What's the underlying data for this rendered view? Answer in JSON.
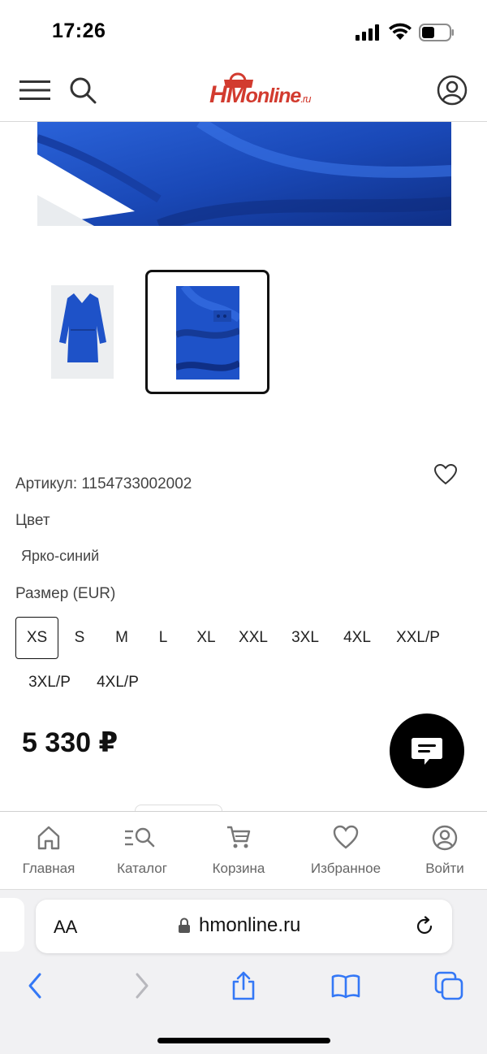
{
  "status_bar": {
    "time": "17:26"
  },
  "header": {
    "logo": {
      "hm": "HM",
      "online": "online",
      "ru": ".ru"
    }
  },
  "product": {
    "article": "Артикул: 1154733002002",
    "color_label": "Цвет",
    "color_value": "Ярко-синий",
    "size_label": "Размер (EUR)",
    "sizes": [
      "XS",
      "S",
      "M",
      "L",
      "XL",
      "XXL",
      "3XL",
      "4XL",
      "XXL/P",
      "3XL/P",
      "4XL/P"
    ],
    "selected_size": "XS",
    "price": "5 330 ₽",
    "accent_color": "#1e52c8"
  },
  "bottom_nav": {
    "items": [
      {
        "label": "Главная",
        "icon": "home-icon"
      },
      {
        "label": "Каталог",
        "icon": "catalog-search-icon"
      },
      {
        "label": "Корзина",
        "icon": "cart-icon"
      },
      {
        "label": "Избранное",
        "icon": "heart-icon"
      },
      {
        "label": "Войти",
        "icon": "user-icon"
      }
    ]
  },
  "browser": {
    "text_size_label": "AA",
    "url": "hmonline.ru"
  },
  "colors": {
    "brand": "#d23b2f",
    "ios_blue": "#3478f6"
  }
}
